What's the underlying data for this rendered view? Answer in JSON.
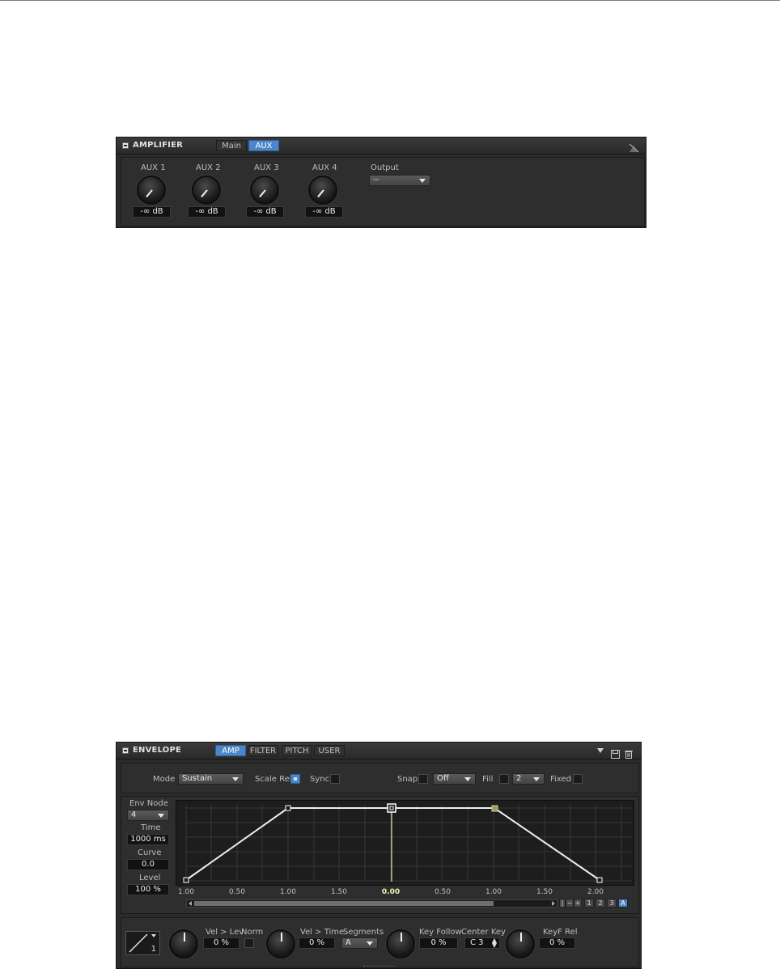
{
  "amplifier": {
    "title": "AMPLIFIER",
    "tabs": [
      {
        "label": "Main",
        "active": false
      },
      {
        "label": "AUX",
        "active": true
      }
    ],
    "aux": [
      {
        "label": "AUX 1",
        "value": "-∞ dB"
      },
      {
        "label": "AUX 2",
        "value": "-∞ dB"
      },
      {
        "label": "AUX 3",
        "value": "-∞ dB"
      },
      {
        "label": "AUX 4",
        "value": "-∞ dB"
      }
    ],
    "output": {
      "label": "Output",
      "value": "--"
    }
  },
  "envelope": {
    "title": "ENVELOPE",
    "tabs": [
      {
        "label": "AMP",
        "active": true
      },
      {
        "label": "FILTER",
        "active": false
      },
      {
        "label": "PITCH",
        "active": false
      },
      {
        "label": "USER",
        "active": false
      }
    ],
    "mode": {
      "label": "Mode",
      "value": "Sustain"
    },
    "scale_rel": {
      "label": "Scale Rel",
      "checked": true
    },
    "sync": {
      "label": "Sync",
      "checked": false
    },
    "snap": {
      "label": "Snap",
      "checked": false,
      "value": "Off"
    },
    "fill": {
      "label": "Fill",
      "checked": false,
      "value": "2"
    },
    "fixed": {
      "label": "Fixed",
      "checked": false
    },
    "env_node": {
      "label": "Env Node",
      "value": "4"
    },
    "time": {
      "label": "Time",
      "value": "1000 ms"
    },
    "curve": {
      "label": "Curve",
      "value": "0.0"
    },
    "level": {
      "label": "Level",
      "value": "100 %"
    },
    "timeline_ticks": [
      "1.00",
      "0.50",
      "1.00",
      "1.50",
      "0.00",
      "0.50",
      "1.00",
      "1.50",
      "2.00"
    ],
    "zoom_buttons": [
      "1",
      "2",
      "3",
      "A"
    ],
    "zoom_controls": [
      "|",
      "−",
      "+"
    ],
    "bottom": {
      "curve_preset": "1",
      "vel_lev": {
        "label": "Vel > Lev",
        "value": "0 %"
      },
      "norm": {
        "label": "Norm",
        "checked": false
      },
      "vel_time": {
        "label": "Vel > Time",
        "value": "0 %"
      },
      "segments": {
        "label": "Segments",
        "value": "A"
      },
      "key_follow": {
        "label": "Key Follow",
        "value": "0 %"
      },
      "center_key": {
        "label": "Center Key",
        "value": "C 3"
      },
      "keyf_rel": {
        "label": "KeyF Rel",
        "value": "0 %"
      }
    },
    "colors": {
      "accent": "#4a86c8",
      "sustain_node": "#a09a60",
      "playline": "#e8e8b0"
    }
  }
}
